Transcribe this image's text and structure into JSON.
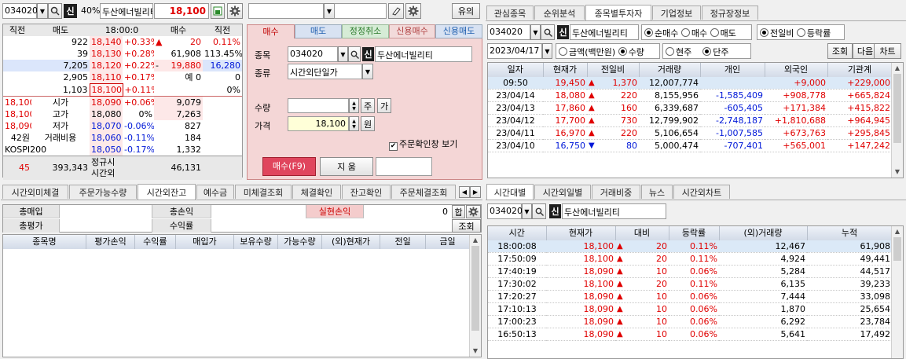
{
  "left": {
    "code": "034020",
    "shin": "신",
    "margin": "40%",
    "name": "두산에너빌리티",
    "price": "18,100",
    "right_btn": "유의",
    "ob_headers": [
      "직전",
      "매도",
      "18:00:0",
      "매수",
      "직전"
    ],
    "ask_rows": [
      {
        "qty": "922",
        "price": "18,140",
        "pct": "+0.33%",
        "mark": "▲",
        "bid": "20",
        "bidpct": "0.11%"
      },
      {
        "qty": "39",
        "price": "18,130",
        "pct": "+0.28%",
        "mark": "",
        "bid": "61,908",
        "bidpct": "113.45%"
      },
      {
        "qty": "7,205",
        "price": "18,120",
        "pct": "+0.22%",
        "mark": "-",
        "bid": "19,880",
        "bidpct": "16,280"
      },
      {
        "qty": "2,905",
        "price": "18,110",
        "pct": "+0.17%",
        "mark": "",
        "bid": "예  0",
        "bidpct": "0"
      },
      {
        "qty": "1,103",
        "price": "18,100",
        "pct": "+0.11%",
        "mark": "",
        "bid": "",
        "bidpct": "0%"
      }
    ],
    "bid_rows": [
      {
        "prev": "18,100",
        "label": "시가",
        "price": "18,090",
        "pct": "+0.06%",
        "qty": "9,079"
      },
      {
        "prev": "18,100",
        "label": "고가",
        "price": "18,080",
        "pct": "0%",
        "qty": "7,263"
      },
      {
        "prev": "18,090",
        "label": "저가",
        "price": "18,070",
        "pct": "-0.06%",
        "qty": "827"
      },
      {
        "prev": "42원",
        "label": "거래비용",
        "price": "18,060",
        "pct": "-0.11%",
        "qty": "184"
      },
      {
        "prev": "KOSPI200",
        "label": "",
        "price": "18,050",
        "pct": "-0.17%",
        "qty": "1,332"
      }
    ],
    "totals": {
      "a": "45",
      "b": "393,343",
      "c": "정규시",
      "c2": "시간외",
      "d": "46,131"
    }
  },
  "order": {
    "tabs": [
      "매수",
      "매도",
      "정정취소",
      "신용매수",
      "신용매도"
    ],
    "label_code": "종목",
    "code": "034020",
    "name": "두산에너빌리티",
    "label_type": "종류",
    "type": "시간외단일가",
    "label_qty": "수량",
    "qty": "",
    "btn_ju": "주",
    "btn_ga": "가",
    "label_price": "가격",
    "price": "18,100",
    "unit": "원",
    "confirm": "주문확인창 보기",
    "buy_btn": "매수(F9)",
    "alt_btn": "지  움"
  },
  "right_top": {
    "tabs": [
      "관심종목",
      "순위분석",
      "종목별투자자",
      "기업정보",
      "정규장정보"
    ],
    "code": "034020",
    "name": "두산에너빌리티",
    "opts1": [
      "순매수",
      "매수",
      "매도"
    ],
    "opts2": [
      "전일비",
      "등락률"
    ],
    "date": "2023/04/17",
    "opts3": [
      "금액(백만원)",
      "수량"
    ],
    "opts4": [
      "현주",
      "단주"
    ],
    "btns": [
      "조회",
      "다음",
      "차트"
    ],
    "headers": [
      "일자",
      "현재가",
      "전일비",
      "거래량",
      "개인",
      "외국인",
      "기관계"
    ],
    "rows": [
      {
        "d": "09:50",
        "p": "19,450",
        "dir": "up",
        "c": "1,370",
        "v": "12,007,774",
        "ind": "",
        "for": "+9,000",
        "inst": "+229,000"
      },
      {
        "d": "23/04/14",
        "p": "18,080",
        "dir": "up",
        "c": "220",
        "v": "8,155,956",
        "ind": "-1,585,409",
        "for": "+908,778",
        "inst": "+665,824"
      },
      {
        "d": "23/04/13",
        "p": "17,860",
        "dir": "up",
        "c": "160",
        "v": "6,339,687",
        "ind": "-605,405",
        "for": "+171,384",
        "inst": "+415,822"
      },
      {
        "d": "23/04/12",
        "p": "17,700",
        "dir": "up",
        "c": "730",
        "v": "12,799,902",
        "ind": "-2,748,187",
        "for": "+1,810,688",
        "inst": "+964,945"
      },
      {
        "d": "23/04/11",
        "p": "16,970",
        "dir": "up",
        "c": "220",
        "v": "5,106,654",
        "ind": "-1,007,585",
        "for": "+673,763",
        "inst": "+295,845"
      },
      {
        "d": "23/04/10",
        "p": "16,750",
        "dir": "down",
        "c": "80",
        "v": "5,000,474",
        "ind": "-707,401",
        "for": "+565,001",
        "inst": "+147,242"
      }
    ]
  },
  "bottom_left": {
    "tabs": [
      "시간외미체결",
      "주문가능수량",
      "시간외잔고",
      "예수금",
      "미체결조회",
      "체결확인",
      "잔고확인",
      "주문체결조회"
    ],
    "labels": {
      "buy_total": "총매입",
      "loss_total": "총손익",
      "realized": "실현손익",
      "eval_total": "총평가",
      "yield": "수익률"
    },
    "realized_value": "0",
    "btn_sum": "합",
    "btn_query": "조회",
    "headers": [
      "종목명",
      "평가손익",
      "수익률",
      "매입가",
      "보유수량",
      "가능수량",
      "(외)현재가",
      "전일",
      "금일"
    ]
  },
  "bottom_right": {
    "tabs": [
      "시간대별",
      "시간외일별",
      "거래비중",
      "뉴스",
      "시간외차트"
    ],
    "code": "034020",
    "name": "두산에너빌리티",
    "headers": [
      "시간",
      "현재가",
      "대비",
      "등락률",
      "(외)거래량",
      "누적"
    ],
    "rows": [
      {
        "t": "18:00:08",
        "p": "18,100",
        "c": "20",
        "r": "0.11%",
        "v": "12,467",
        "cum": "61,908"
      },
      {
        "t": "17:50:09",
        "p": "18,100",
        "c": "20",
        "r": "0.11%",
        "v": "4,924",
        "cum": "49,441"
      },
      {
        "t": "17:40:19",
        "p": "18,090",
        "c": "10",
        "r": "0.06%",
        "v": "5,284",
        "cum": "44,517"
      },
      {
        "t": "17:30:02",
        "p": "18,100",
        "c": "20",
        "r": "0.11%",
        "v": "6,135",
        "cum": "39,233"
      },
      {
        "t": "17:20:27",
        "p": "18,090",
        "c": "10",
        "r": "0.06%",
        "v": "7,444",
        "cum": "33,098"
      },
      {
        "t": "17:10:13",
        "p": "18,090",
        "c": "10",
        "r": "0.06%",
        "v": "1,870",
        "cum": "25,654"
      },
      {
        "t": "17:00:23",
        "p": "18,090",
        "c": "10",
        "r": "0.06%",
        "v": "6,292",
        "cum": "23,784"
      },
      {
        "t": "16:50:13",
        "p": "18,090",
        "c": "10",
        "r": "0.06%",
        "v": "5,641",
        "cum": "17,492"
      }
    ]
  },
  "colors": {
    "up": "#e00000",
    "down": "#0018d8",
    "buy_panel": "#f4d6d6",
    "buy_button": "#e0455d"
  }
}
